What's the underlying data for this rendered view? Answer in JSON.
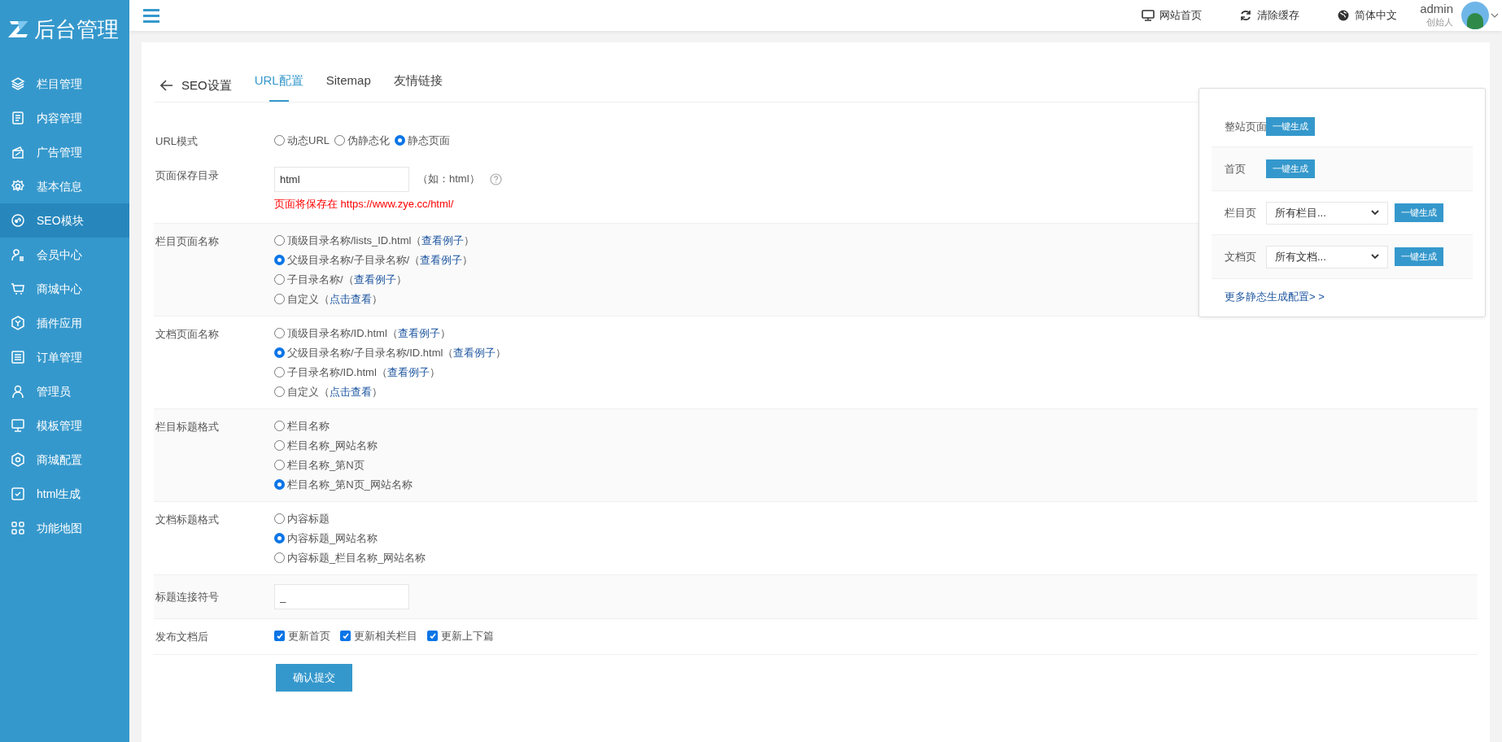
{
  "brand": {
    "title": "后台管理"
  },
  "sidebar": {
    "items": [
      {
        "label": "栏目管理",
        "selected": false
      },
      {
        "label": "内容管理",
        "selected": false
      },
      {
        "label": "广告管理",
        "selected": false
      },
      {
        "label": "基本信息",
        "selected": false
      },
      {
        "label": "SEO模块",
        "selected": true
      },
      {
        "label": "会员中心",
        "selected": false
      },
      {
        "label": "商城中心",
        "selected": false
      },
      {
        "label": "插件应用",
        "selected": false
      },
      {
        "label": "订单管理",
        "selected": false
      },
      {
        "label": "管理员",
        "selected": false
      },
      {
        "label": "模板管理",
        "selected": false
      },
      {
        "label": "商城配置",
        "selected": false
      },
      {
        "label": "html生成",
        "selected": false
      },
      {
        "label": "功能地图",
        "selected": false
      }
    ]
  },
  "header": {
    "links": [
      {
        "label": "网站首页"
      },
      {
        "label": "清除缓存"
      },
      {
        "label": "简体中文"
      }
    ],
    "user": {
      "name": "admin",
      "role": "创始人"
    }
  },
  "back_title": "SEO设置",
  "tabs": [
    {
      "label": "URL配置",
      "selected": true
    },
    {
      "label": "Sitemap",
      "selected": false
    },
    {
      "label": "友情链接",
      "selected": false
    }
  ],
  "form": {
    "rows": [
      {
        "kind": "radio-inline",
        "label": "URL模式",
        "options": [
          {
            "label": "动态URL",
            "selected": false
          },
          {
            "label": "伪静态化",
            "selected": false
          },
          {
            "label": "静态页面",
            "selected": true
          }
        ]
      },
      {
        "kind": "text",
        "label": "页面保存目录",
        "value": "html",
        "suffix": "（如：html）",
        "hint": "页面将保存在 https://www.zye.cc/html/"
      },
      {
        "kind": "radio",
        "label": "栏目页面名称",
        "options": [
          {
            "label": "顶级目录名称/lists_ID.html（",
            "link": "查看例子",
            "after": "）",
            "selected": false
          },
          {
            "label": "父级目录名称/子目录名称/（",
            "link": "查看例子",
            "after": "）",
            "selected": true
          },
          {
            "label": "子目录名称/（",
            "link": "查看例子",
            "after": "）",
            "selected": false
          },
          {
            "label": "自定义（",
            "link": "点击查看",
            "after": "）",
            "selected": false
          }
        ]
      },
      {
        "kind": "radio",
        "label": "文档页面名称",
        "options": [
          {
            "label": "顶级目录名称/ID.html（",
            "link": "查看例子",
            "after": "）",
            "selected": false
          },
          {
            "label": "父级目录名称/子目录名称/ID.html（",
            "link": "查看例子",
            "after": "）",
            "selected": true
          },
          {
            "label": "子目录名称/ID.html（",
            "link": "查看例子",
            "after": "）",
            "selected": false
          },
          {
            "label": "自定义（",
            "link": "点击查看",
            "after": "）",
            "selected": false
          }
        ]
      },
      {
        "kind": "radio",
        "label": "栏目标题格式",
        "options": [
          {
            "label": "栏目名称",
            "selected": false
          },
          {
            "label": "栏目名称_网站名称",
            "selected": false
          },
          {
            "label": "栏目名称_第N页",
            "selected": false
          },
          {
            "label": "栏目名称_第N页_网站名称",
            "selected": true
          }
        ]
      },
      {
        "kind": "radio",
        "label": "文档标题格式",
        "options": [
          {
            "label": "内容标题",
            "selected": false
          },
          {
            "label": "内容标题_网站名称",
            "selected": true
          },
          {
            "label": "内容标题_栏目名称_网站名称",
            "selected": false
          }
        ]
      },
      {
        "kind": "text",
        "label": "标题连接符号",
        "value": "_"
      },
      {
        "kind": "checkbox",
        "label": "发布文档后",
        "options": [
          {
            "label": "更新首页",
            "checked": true
          },
          {
            "label": "更新相关栏目",
            "checked": true
          },
          {
            "label": "更新上下篇",
            "checked": true
          }
        ]
      }
    ],
    "submit": "确认提交"
  },
  "generate_panel": {
    "rows": [
      {
        "label": "整站页面",
        "button": "一键生成"
      },
      {
        "label": "首页",
        "button": "一键生成"
      },
      {
        "label": "栏目页",
        "select": "所有栏目...",
        "button": "一键生成"
      },
      {
        "label": "文档页",
        "select": "所有文档...",
        "button": "一键生成"
      }
    ],
    "more_link": "更多静态生成配置> >"
  }
}
